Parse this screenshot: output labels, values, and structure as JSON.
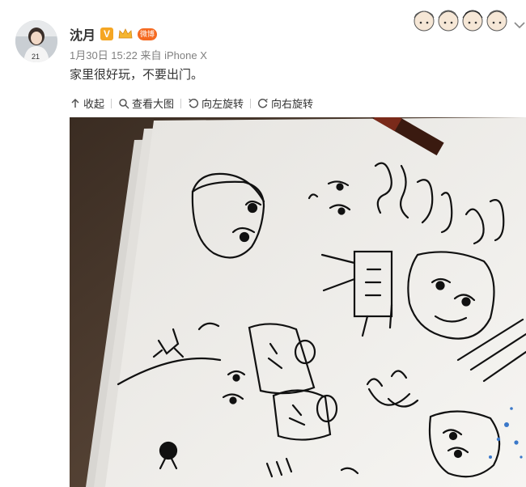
{
  "post": {
    "author": "沈月",
    "verified_badge": "V",
    "vip_badge": "微博",
    "time": "1月30日 15:22",
    "source_prefix": "来自",
    "source": "iPhone X",
    "text": "家里很好玩，不要出门。"
  },
  "toolbar": {
    "collapse": "收起",
    "view_large": "查看大图",
    "rotate_left": "向左旋转",
    "rotate_right": "向右旋转"
  },
  "colors": {
    "name": "#333333",
    "meta": "#808080",
    "verified": "#f5a623",
    "vip": "#f56a21"
  },
  "icons": [
    "collapse-icon",
    "magnifier-icon",
    "rotate-left-icon",
    "rotate-right-icon",
    "chevron-down-icon"
  ]
}
